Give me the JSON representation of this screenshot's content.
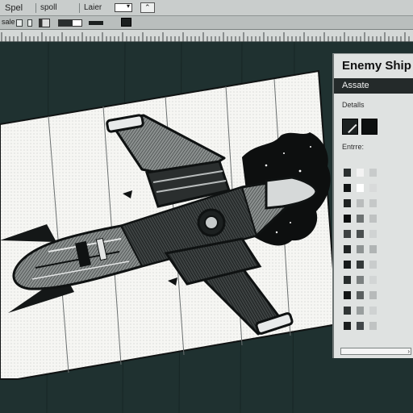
{
  "toolbar": {
    "menu_1": "Spel",
    "menu_2": "spoll",
    "menu_3": "Laier",
    "field_label": "sale"
  },
  "panel": {
    "title": "Enemy Ship",
    "tab_label": "Assate",
    "details_label": "Detalls",
    "entries_label": "Entrre:"
  },
  "colors": {
    "workspace": "#1f3130",
    "toolbar": "#c9cdcc",
    "panel": "#dfe2e1",
    "tab_active": "#242a2a",
    "artboard": "#f4f4f1",
    "ink": "#151818"
  }
}
